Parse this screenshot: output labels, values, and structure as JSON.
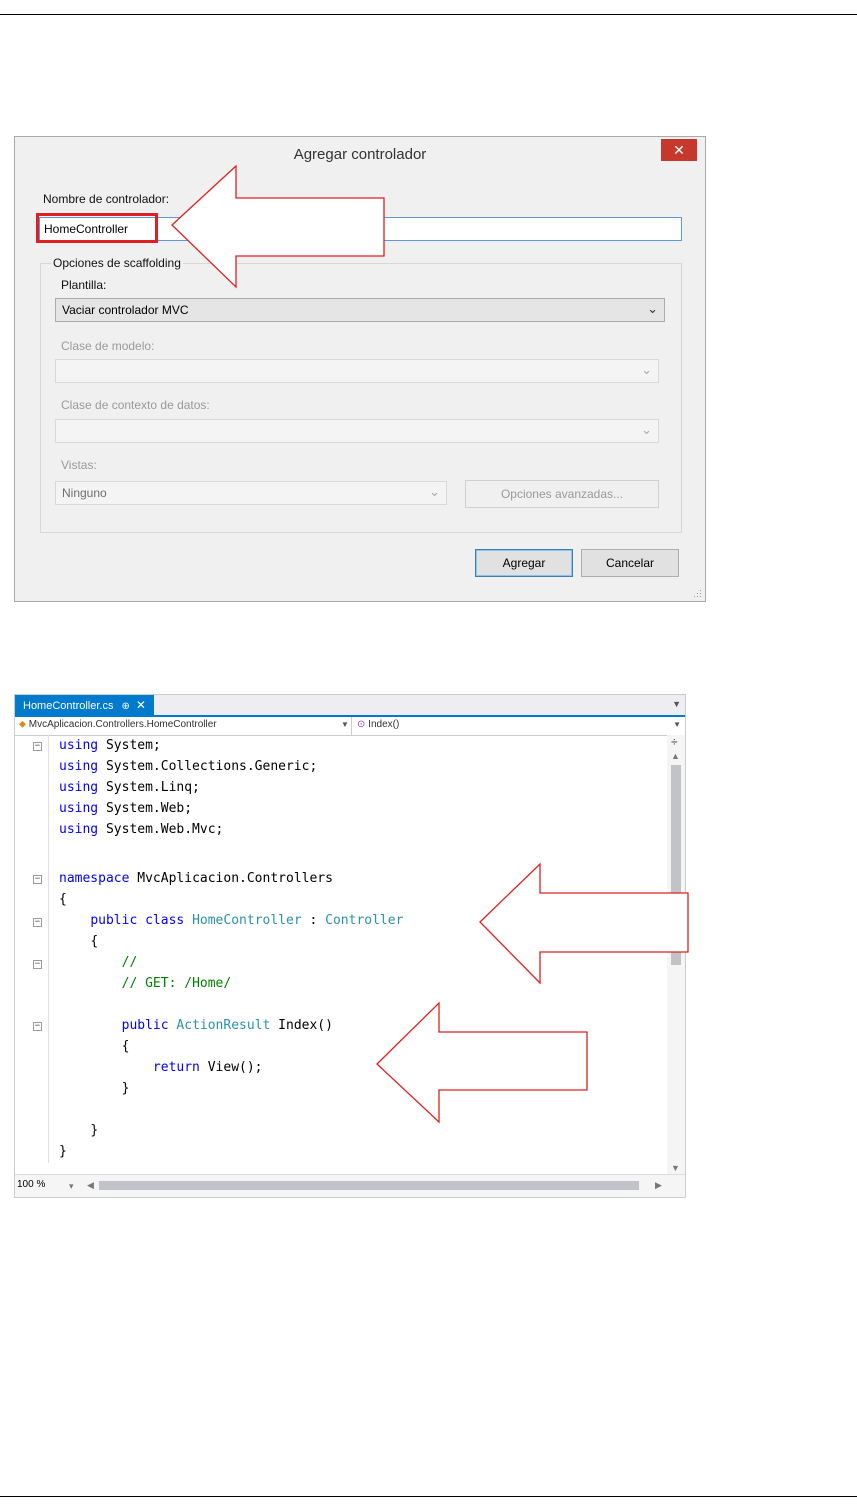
{
  "dialog": {
    "title": "Agregar controlador",
    "close_glyph": "✕",
    "name_label": "Nombre de controlador:",
    "name_value": "HomeController",
    "scaffolding_group": "Opciones de scaffolding",
    "template_label": "Plantilla:",
    "template_value": "Vaciar controlador MVC",
    "model_label": "Clase de modelo:",
    "model_value": "",
    "context_label": "Clase de contexto de datos:",
    "context_value": "",
    "views_label": "Vistas:",
    "views_value": "Ninguno",
    "advanced_button": "Opciones avanzadas...",
    "add_button": "Agregar",
    "cancel_button": "Cancelar"
  },
  "editor": {
    "tab_label": "HomeController.cs",
    "tab_pin": "⊕",
    "tab_close": "✕",
    "nav_class": "MvcAplicacion.Controllers.HomeController",
    "nav_member": "Index()",
    "zoom": "100 %",
    "code": {
      "l1": "System;",
      "l2": "System.Collections.Generic;",
      "l3": "System.Linq;",
      "l4": "System.Web;",
      "l5": "System.Web.Mvc;",
      "ns_name": "MvcAplicacion.Controllers",
      "brace_open": "{",
      "brace_close": "}",
      "class_name": "HomeController",
      "base_class": "Controller",
      "comment1": "//",
      "comment2": "// GET: /Home/",
      "return_type": "ActionResult",
      "method": " Index()",
      "return_expr": " View();",
      "kw_using": "using",
      "kw_namespace": "namespace",
      "kw_public": "public",
      "kw_class": "class",
      "kw_return": "return",
      "colon": " : "
    }
  },
  "colors": {
    "accent": "#007acc",
    "close": "#c7382c",
    "annotation": "#e02020",
    "keyword": "#0000ff",
    "type": "#2b91af",
    "comment": "#008000"
  }
}
